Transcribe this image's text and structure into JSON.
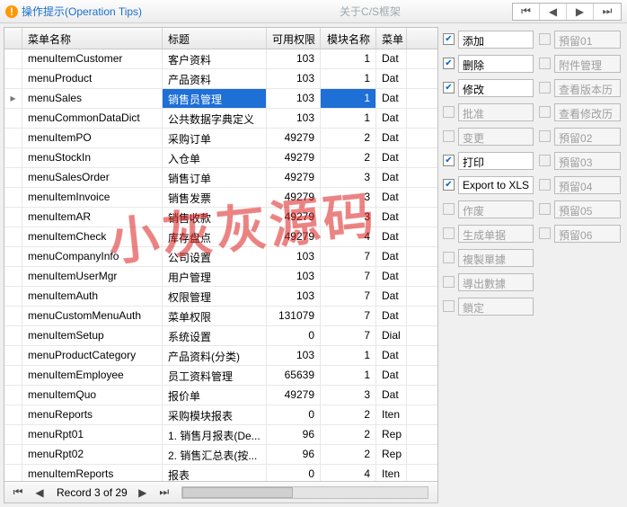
{
  "header": {
    "tips_label": "操作提示(Operation Tips)",
    "about_label": "关于C/S框架"
  },
  "grid": {
    "columns": [
      "菜单名称",
      "标题",
      "可用权限",
      "模块名称",
      "菜单"
    ],
    "selected_index": 2,
    "rows": [
      {
        "name": "menuItemCustomer",
        "title": "客户资料",
        "perm": "103",
        "module": "1",
        "last": "Dat"
      },
      {
        "name": "menuProduct",
        "title": "产品资料",
        "perm": "103",
        "module": "1",
        "last": "Dat"
      },
      {
        "name": "menuSales",
        "title": "销售员管理",
        "perm": "103",
        "module": "1",
        "last": "Dat"
      },
      {
        "name": "menuCommonDataDict",
        "title": "公共数据字典定义",
        "perm": "103",
        "module": "1",
        "last": "Dat"
      },
      {
        "name": "menuItemPO",
        "title": "采购订单",
        "perm": "49279",
        "module": "2",
        "last": "Dat"
      },
      {
        "name": "menuStockIn",
        "title": "入仓单",
        "perm": "49279",
        "module": "2",
        "last": "Dat"
      },
      {
        "name": "menuSalesOrder",
        "title": "销售订单",
        "perm": "49279",
        "module": "3",
        "last": "Dat"
      },
      {
        "name": "menuItemInvoice",
        "title": "销售发票",
        "perm": "49279",
        "module": "3",
        "last": "Dat"
      },
      {
        "name": "menuItemAR",
        "title": "销售收款",
        "perm": "49279",
        "module": "3",
        "last": "Dat"
      },
      {
        "name": "menuItemCheck",
        "title": "库存盘点",
        "perm": "49279",
        "module": "4",
        "last": "Dat"
      },
      {
        "name": "menuCompanyInfo",
        "title": "公司设置",
        "perm": "103",
        "module": "7",
        "last": "Dat"
      },
      {
        "name": "menuItemUserMgr",
        "title": "用户管理",
        "perm": "103",
        "module": "7",
        "last": "Dat"
      },
      {
        "name": "menuItemAuth",
        "title": "权限管理",
        "perm": "103",
        "module": "7",
        "last": "Dat"
      },
      {
        "name": "menuCustomMenuAuth",
        "title": "菜单权限",
        "perm": "131079",
        "module": "7",
        "last": "Dat"
      },
      {
        "name": "menuItemSetup",
        "title": "系统设置",
        "perm": "0",
        "module": "7",
        "last": "Dial"
      },
      {
        "name": "menuProductCategory",
        "title": "产品资料(分类)",
        "perm": "103",
        "module": "1",
        "last": "Dat"
      },
      {
        "name": "menuItemEmployee",
        "title": "员工资料管理",
        "perm": "65639",
        "module": "1",
        "last": "Dat"
      },
      {
        "name": "menuItemQuo",
        "title": "报价单",
        "perm": "49279",
        "module": "3",
        "last": "Dat"
      },
      {
        "name": "menuReports",
        "title": "采购模块报表",
        "perm": "0",
        "module": "2",
        "last": "Iten"
      },
      {
        "name": "menuRpt01",
        "title": "1. 销售月报表(De...",
        "perm": "96",
        "module": "2",
        "last": "Rep"
      },
      {
        "name": "menuRpt02",
        "title": "2. 销售汇总表(按...",
        "perm": "96",
        "module": "2",
        "last": "Rep"
      },
      {
        "name": "menuItemReports",
        "title": "报表",
        "perm": "0",
        "module": "4",
        "last": "Iten"
      }
    ],
    "pager_text": "Record 3 of 29"
  },
  "side": {
    "left": [
      {
        "label": "添加",
        "checked": true,
        "enabled": true
      },
      {
        "label": "删除",
        "checked": true,
        "enabled": true
      },
      {
        "label": "修改",
        "checked": true,
        "enabled": true
      },
      {
        "label": "批准",
        "checked": false,
        "enabled": false
      },
      {
        "label": "变更",
        "checked": false,
        "enabled": false
      },
      {
        "label": "打印",
        "checked": true,
        "enabled": true
      },
      {
        "label": "Export to XLS",
        "checked": true,
        "enabled": true
      },
      {
        "label": "作废",
        "checked": false,
        "enabled": false
      },
      {
        "label": "生成单据",
        "checked": false,
        "enabled": false
      },
      {
        "label": "複製單據",
        "checked": false,
        "enabled": false
      },
      {
        "label": "導出數據",
        "checked": false,
        "enabled": false
      },
      {
        "label": "鎖定",
        "checked": false,
        "enabled": false
      }
    ],
    "right": [
      {
        "label": "預留01",
        "checked": false,
        "enabled": false
      },
      {
        "label": "附件管理",
        "checked": false,
        "enabled": false
      },
      {
        "label": "查看版本历",
        "checked": false,
        "enabled": false
      },
      {
        "label": "查看修改历",
        "checked": false,
        "enabled": false
      },
      {
        "label": "預留02",
        "checked": false,
        "enabled": false
      },
      {
        "label": "預留03",
        "checked": false,
        "enabled": false
      },
      {
        "label": "預留04",
        "checked": false,
        "enabled": false
      },
      {
        "label": "預留05",
        "checked": false,
        "enabled": false
      },
      {
        "label": "預留06",
        "checked": false,
        "enabled": false
      }
    ]
  },
  "watermark": "小灰灰源码"
}
